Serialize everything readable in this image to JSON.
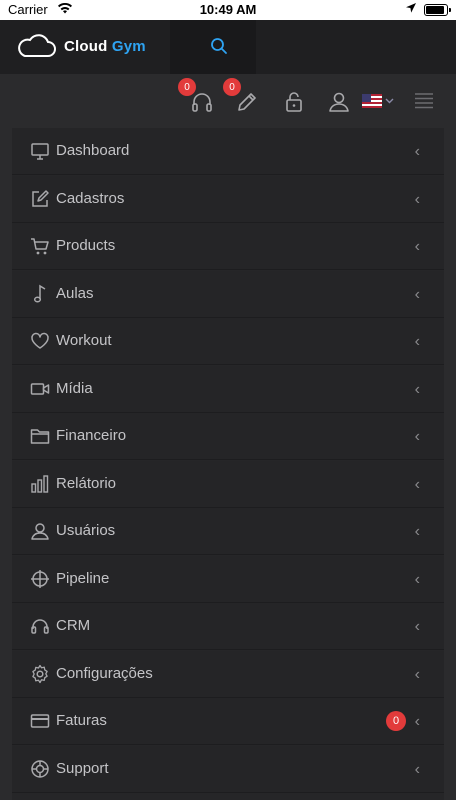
{
  "status_bar": {
    "carrier": "Carrier",
    "time": "10:49 AM"
  },
  "header": {
    "logo_word1": "Cloud",
    "logo_word2": "Gym",
    "accent_color": "#2ea3f2"
  },
  "toolbar": {
    "support_badge": "0",
    "edit_badge": "0",
    "icons": [
      "headphones-icon",
      "pencil-icon",
      "lock-icon",
      "user-icon",
      "us-flag-icon",
      "menu-icon"
    ]
  },
  "menu": {
    "items": [
      {
        "label": "Dashboard",
        "icon": "monitor-icon"
      },
      {
        "label": "Cadastros",
        "icon": "edit-icon"
      },
      {
        "label": "Products",
        "icon": "cart-icon"
      },
      {
        "label": "Aulas",
        "icon": "music-note-icon"
      },
      {
        "label": "Workout",
        "icon": "heart-icon"
      },
      {
        "label": "Mídia",
        "icon": "video-icon"
      },
      {
        "label": "Financeiro",
        "icon": "folder-icon"
      },
      {
        "label": "Relátorio",
        "icon": "bar-chart-icon"
      },
      {
        "label": "Usuários",
        "icon": "user-icon"
      },
      {
        "label": "Pipeline",
        "icon": "crosshair-icon"
      },
      {
        "label": "CRM",
        "icon": "headset-icon"
      },
      {
        "label": "Configurações",
        "icon": "gear-icon"
      },
      {
        "label": "Faturas",
        "icon": "credit-card-icon",
        "badge": "0"
      },
      {
        "label": "Support",
        "icon": "lifebuoy-icon"
      }
    ],
    "chevron": "‹"
  }
}
